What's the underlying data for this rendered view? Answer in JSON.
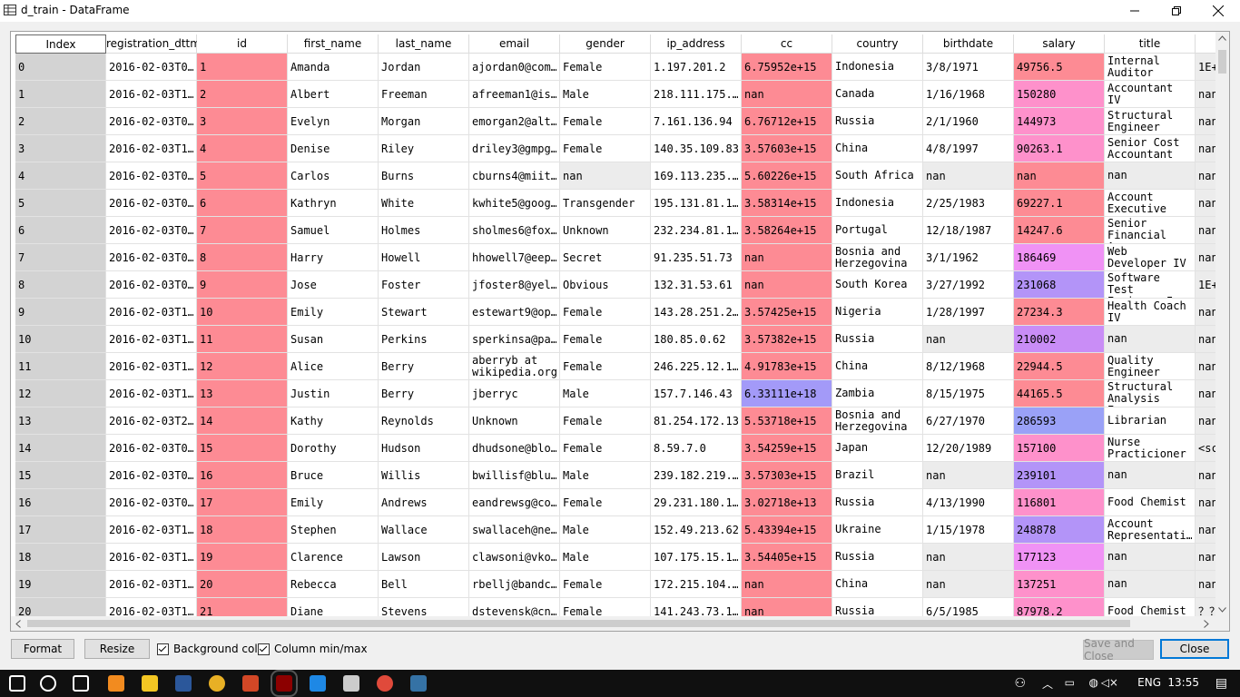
{
  "window": {
    "title": "d_train - DataFrame"
  },
  "columns": [
    "Index",
    "registration_dttm",
    "id",
    "first_name",
    "last_name",
    "email",
    "gender",
    "ip_address",
    "cc",
    "country",
    "birthdate",
    "salary",
    "title",
    ""
  ],
  "rows": [
    [
      "0",
      "2016-02-03T0…",
      "1",
      "Amanda",
      "Jordan",
      "ajordan0@com…",
      "Female",
      "1.197.201.2",
      "6.75952e+15",
      "Indonesia",
      "3/8/1971",
      "49756.5",
      "Internal Auditor",
      "1E+"
    ],
    [
      "1",
      "2016-02-03T1…",
      "2",
      "Albert",
      "Freeman",
      "afreeman1@is…",
      "Male",
      "218.111.175.…",
      "nan",
      "Canada",
      "1/16/1968",
      "150280",
      "Accountant IV",
      "nan"
    ],
    [
      "2",
      "2016-02-03T0…",
      "3",
      "Evelyn",
      "Morgan",
      "emorgan2@alt…",
      "Female",
      "7.161.136.94",
      "6.76712e+15",
      "Russia",
      "2/1/1960",
      "144973",
      "Structural Engineer",
      "nan"
    ],
    [
      "3",
      "2016-02-03T1…",
      "4",
      "Denise",
      "Riley",
      "driley3@gmpg…",
      "Female",
      "140.35.109.83",
      "3.57603e+15",
      "China",
      "4/8/1997",
      "90263.1",
      "Senior Cost Accountant",
      "nan"
    ],
    [
      "4",
      "2016-02-03T0…",
      "5",
      "Carlos",
      "Burns",
      "cburns4@miit…",
      "nan",
      "169.113.235.…",
      "5.60226e+15",
      "South Africa",
      "nan",
      "nan",
      "nan",
      "nan"
    ],
    [
      "5",
      "2016-02-03T0…",
      "6",
      "Kathryn",
      "White",
      "kwhite5@goog…",
      "Transgender",
      "195.131.81.1…",
      "3.58314e+15",
      "Indonesia",
      "2/25/1983",
      "69227.1",
      "Account Executive",
      "nan"
    ],
    [
      "6",
      "2016-02-03T0…",
      "7",
      "Samuel",
      "Holmes",
      "sholmes6@fox…",
      "Unknown",
      "232.234.81.1…",
      "3.58264e+15",
      "Portugal",
      "12/18/1987",
      "14247.6",
      "Senior Financial An…",
      "nan"
    ],
    [
      "7",
      "2016-02-03T0…",
      "8",
      "Harry",
      "Howell",
      "hhowell7@eep…",
      "Secret",
      "91.235.51.73",
      "nan",
      "Bosnia and Herzegovina",
      "3/1/1962",
      "186469",
      "Web Developer IV",
      "nan"
    ],
    [
      "8",
      "2016-02-03T0…",
      "9",
      "Jose",
      "Foster",
      "jfoster8@yel…",
      "Obvious",
      "132.31.53.61",
      "nan",
      "South Korea",
      "3/27/1992",
      "231068",
      "Software Test Engineer I",
      "1E+"
    ],
    [
      "9",
      "2016-02-03T1…",
      "10",
      "Emily",
      "Stewart",
      "estewart9@op…",
      "Female",
      "143.28.251.2…",
      "3.57425e+15",
      "Nigeria",
      "1/28/1997",
      "27234.3",
      "Health Coach IV",
      "nan"
    ],
    [
      "10",
      "2016-02-03T1…",
      "11",
      "Susan",
      "Perkins",
      "sperkinsa@pa…",
      "Female",
      "180.85.0.62",
      "3.57382e+15",
      "Russia",
      "nan",
      "210002",
      "nan",
      "nan"
    ],
    [
      "11",
      "2016-02-03T1…",
      "12",
      "Alice",
      "Berry",
      "aberryb at wikipedia.org",
      "Female",
      "246.225.12.1…",
      "4.91783e+15",
      "China",
      "8/12/1968",
      "22944.5",
      "Quality Engineer",
      "nan"
    ],
    [
      "12",
      "2016-02-03T1…",
      "13",
      "Justin",
      "Berry",
      "jberryc",
      "Male",
      "157.7.146.43",
      "6.33111e+18",
      "Zambia",
      "8/15/1975",
      "44165.5",
      "Structural Analysis Eng…",
      "nan"
    ],
    [
      "13",
      "2016-02-03T2…",
      "14",
      "Kathy",
      "Reynolds",
      "Unknown",
      "Female",
      "81.254.172.13",
      "5.53718e+15",
      "Bosnia and Herzegovina",
      "6/27/1970",
      "286593",
      "Librarian",
      "nan"
    ],
    [
      "14",
      "2016-02-03T0…",
      "15",
      "Dorothy",
      "Hudson",
      "dhudsone@blo…",
      "Female",
      "8.59.7.0",
      "3.54259e+15",
      "Japan",
      "12/20/1989",
      "157100",
      "Nurse Practicioner",
      "<sc"
    ],
    [
      "15",
      "2016-02-03T0…",
      "16",
      "Bruce",
      "Willis",
      "bwillisf@blu…",
      "Male",
      "239.182.219.…",
      "3.57303e+15",
      "Brazil",
      "nan",
      "239101",
      "nan",
      "nan"
    ],
    [
      "16",
      "2016-02-03T0…",
      "17",
      "Emily",
      "Andrews",
      "eandrewsg@co…",
      "Female",
      "29.231.180.1…",
      "3.02718e+13",
      "Russia",
      "4/13/1990",
      "116801",
      "Food Chemist",
      "nan"
    ],
    [
      "17",
      "2016-02-03T1…",
      "18",
      "Stephen",
      "Wallace",
      "swallaceh@ne…",
      "Male",
      "152.49.213.62",
      "5.43394e+15",
      "Ukraine",
      "1/15/1978",
      "248878",
      "Account Representati…",
      "nan"
    ],
    [
      "18",
      "2016-02-03T1…",
      "19",
      "Clarence",
      "Lawson",
      "clawsoni@vko…",
      "Male",
      "107.175.15.1…",
      "3.54405e+15",
      "Russia",
      "nan",
      "177123",
      "nan",
      "nan"
    ],
    [
      "19",
      "2016-02-03T1…",
      "20",
      "Rebecca",
      "Bell",
      "rbellj@bandc…",
      "Female",
      "172.215.104.…",
      "nan",
      "China",
      "nan",
      "137251",
      "nan",
      "nan"
    ],
    [
      "20",
      "2016-02-03T1…",
      "21",
      "Diane",
      "Stevens",
      "dstevensk@cn…",
      "Female",
      "141.243.73.1…",
      "nan",
      "Russia",
      "6/5/1985",
      "87978.2",
      "Food Chemist",
      "？？"
    ]
  ],
  "colors": {
    "id": "#fd8b94",
    "cc_default": "#fd8b94",
    "cc_high": "#a39af8",
    "nan_grey": "#ececec",
    "salary_scale": [
      "#fd8b94",
      "#fe91cb",
      "#f092f5",
      "#c98df6",
      "#b394f8",
      "#9aa1f7"
    ]
  },
  "buttons": {
    "format": "Format",
    "resize": "Resize",
    "background_color": "Background color",
    "column_minmax": "Column min/max",
    "save_close": "Save and Close",
    "close": "Close"
  },
  "taskbar": {
    "lang": "ENG",
    "time": "13:55",
    "apps": [
      "start-icon",
      "search-icon",
      "task-view-icon",
      "sublime-icon",
      "file-explorer-icon",
      "word-icon",
      "chrome-icon",
      "powerpoint-icon",
      "spyder-icon",
      "edge-icon",
      "photos-icon",
      "groove-icon",
      "python-icon"
    ]
  }
}
